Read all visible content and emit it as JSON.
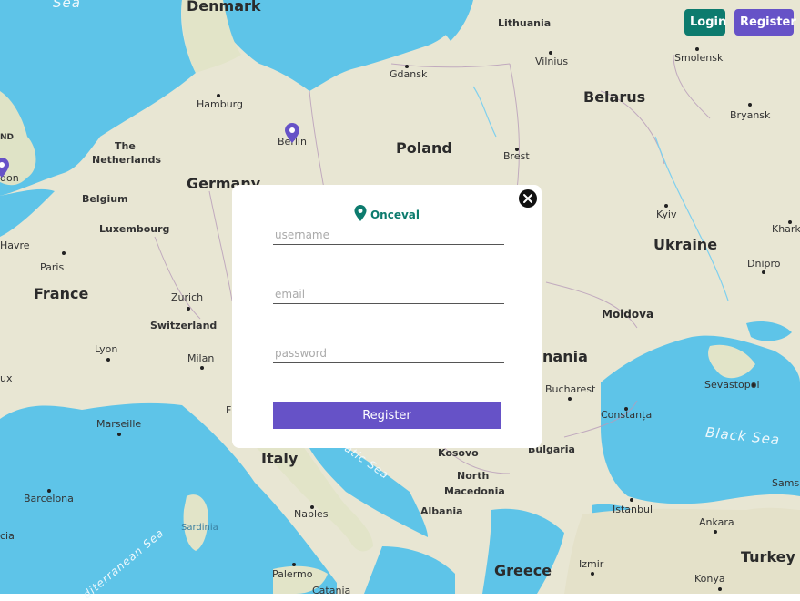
{
  "header": {
    "login_label": "Login",
    "register_label": "Register"
  },
  "map": {
    "countries": [
      "Denmark",
      "Belarus",
      "Poland",
      "Germany",
      "Ukraine",
      "France",
      "Moldova",
      "Italy",
      "Turkey",
      "Greece"
    ],
    "regions": [
      "The",
      "Netherlands",
      "Belgium",
      "Luxembourg",
      "Switzerland",
      "Kosovo",
      "North",
      "Macedonia",
      "Albania",
      "Bulgaria",
      "Lithuania",
      "nania"
    ],
    "cities": [
      "Hamburg",
      "Berlin",
      "Gdansk",
      "Vilnius",
      "Smolensk",
      "Bryansk",
      "Brest",
      "Kyiv",
      "Kharkiv",
      "Dnipro",
      "Paris",
      "Zurich",
      "Lyon",
      "Milan",
      "Marseille",
      "Barcelona",
      "Naples",
      "Palermo",
      "Catania",
      "Bucharest",
      "Constanța",
      "Sevastopol",
      "Istanbul",
      "Ankara",
      "Izmir",
      "Konya",
      "Samsu",
      "don",
      "Havre",
      "ux",
      "celona",
      "cia",
      "F"
    ],
    "seas": [
      "Sea",
      "Black Sea",
      "diterranean Sea",
      "atic Sea"
    ],
    "islands": [
      "Sardinia"
    ],
    "misc": [
      "ND"
    ]
  },
  "modal": {
    "brand": "Onceval",
    "fields": {
      "username_placeholder": "username",
      "email_placeholder": "email",
      "password_placeholder": "password"
    },
    "submit_label": "Register"
  },
  "colors": {
    "teal": "#0d7b6e",
    "purple": "#6652c7",
    "water": "#5ec4e8",
    "land": "#e8e6d3"
  }
}
